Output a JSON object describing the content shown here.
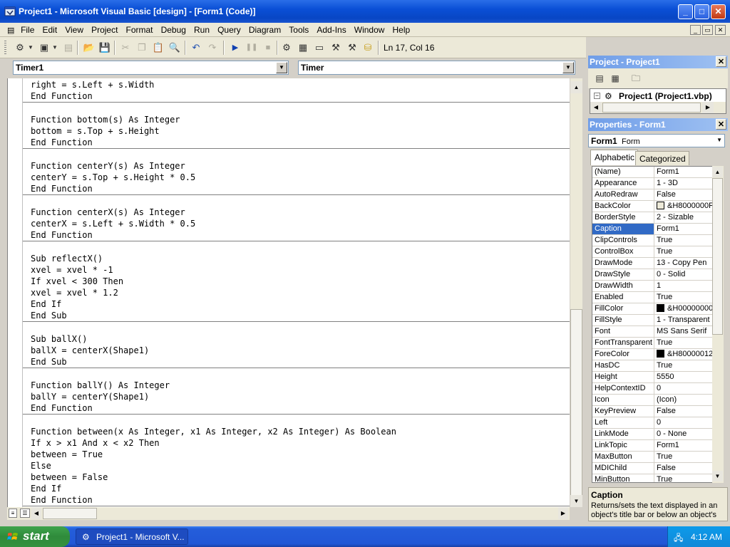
{
  "window": {
    "title": "Project1 - Microsoft Visual Basic [design] - [Form1 (Code)]",
    "controls": [
      "_",
      "□",
      "✕"
    ]
  },
  "menubar": {
    "items": [
      "File",
      "Edit",
      "View",
      "Project",
      "Format",
      "Debug",
      "Run",
      "Query",
      "Diagram",
      "Tools",
      "Add-Ins",
      "Window",
      "Help"
    ],
    "mdi_controls": [
      "_",
      "▭",
      "✕"
    ]
  },
  "toolbar": {
    "status": "Ln 17, Col 16"
  },
  "code_window": {
    "object_combo": "Timer1",
    "proc_combo": "Timer",
    "procedures": [
      [
        "right = s.Left + s.Width",
        "End Function"
      ],
      [
        "Function bottom(s) As Integer",
        "bottom = s.Top + s.Height",
        "End Function"
      ],
      [
        "Function centerY(s) As Integer",
        "centerY = s.Top + s.Height * 0.5",
        "End Function"
      ],
      [
        "Function centerX(s) As Integer",
        "centerX = s.Left + s.Width * 0.5",
        "End Function"
      ],
      [
        "Sub reflectX()",
        "xvel = xvel * -1",
        "If xvel < 300 Then",
        "xvel = xvel * 1.2",
        "End If",
        "End Sub"
      ],
      [
        "Sub ballX()",
        "ballX = centerX(Shape1)",
        "End Sub"
      ],
      [
        "Function ballY() As Integer",
        "ballY = centerY(Shape1)",
        "End Function"
      ],
      [
        "Function between(x As Integer, x1 As Integer, x2 As Integer) As Boolean",
        "If x > x1 And x < x2 Then",
        "between = True",
        "Else",
        "between = False",
        "End If",
        "End Function"
      ]
    ]
  },
  "project_panel": {
    "title": "Project - Project1",
    "tree_item": "Project1 (Project1.vbp)"
  },
  "properties_panel": {
    "title": "Properties - Form1",
    "object_name": "Form1",
    "object_type": "Form",
    "tabs": [
      "Alphabetic",
      "Categorized"
    ],
    "selected_property": "Caption",
    "rows": [
      {
        "name": "(Name)",
        "value": "Form1"
      },
      {
        "name": "Appearance",
        "value": "1 - 3D"
      },
      {
        "name": "AutoRedraw",
        "value": "False"
      },
      {
        "name": "BackColor",
        "value": "&H8000000F",
        "swatch": "#ece9d8"
      },
      {
        "name": "BorderStyle",
        "value": "2 - Sizable"
      },
      {
        "name": "Caption",
        "value": "Form1"
      },
      {
        "name": "ClipControls",
        "value": "True"
      },
      {
        "name": "ControlBox",
        "value": "True"
      },
      {
        "name": "DrawMode",
        "value": "13 - Copy Pen"
      },
      {
        "name": "DrawStyle",
        "value": "0 - Solid"
      },
      {
        "name": "DrawWidth",
        "value": "1"
      },
      {
        "name": "Enabled",
        "value": "True"
      },
      {
        "name": "FillColor",
        "value": "&H00000000",
        "swatch": "#000000"
      },
      {
        "name": "FillStyle",
        "value": "1 - Transparent"
      },
      {
        "name": "Font",
        "value": "MS Sans Serif"
      },
      {
        "name": "FontTransparent",
        "value": "True"
      },
      {
        "name": "ForeColor",
        "value": "&H80000012",
        "swatch": "#000000"
      },
      {
        "name": "HasDC",
        "value": "True"
      },
      {
        "name": "Height",
        "value": "5550"
      },
      {
        "name": "HelpContextID",
        "value": "0"
      },
      {
        "name": "Icon",
        "value": "(Icon)"
      },
      {
        "name": "KeyPreview",
        "value": "False"
      },
      {
        "name": "Left",
        "value": "0"
      },
      {
        "name": "LinkMode",
        "value": "0 - None"
      },
      {
        "name": "LinkTopic",
        "value": "Form1"
      },
      {
        "name": "MaxButton",
        "value": "True"
      },
      {
        "name": "MDIChild",
        "value": "False"
      },
      {
        "name": "MinButton",
        "value": "True"
      }
    ],
    "description_title": "Caption",
    "description_text": "Returns/sets the text displayed in an object's title bar or below an object's"
  },
  "taskbar": {
    "start_label": "start",
    "task_label": "Project1 - Microsoft V...",
    "clock": "4:12 AM"
  }
}
